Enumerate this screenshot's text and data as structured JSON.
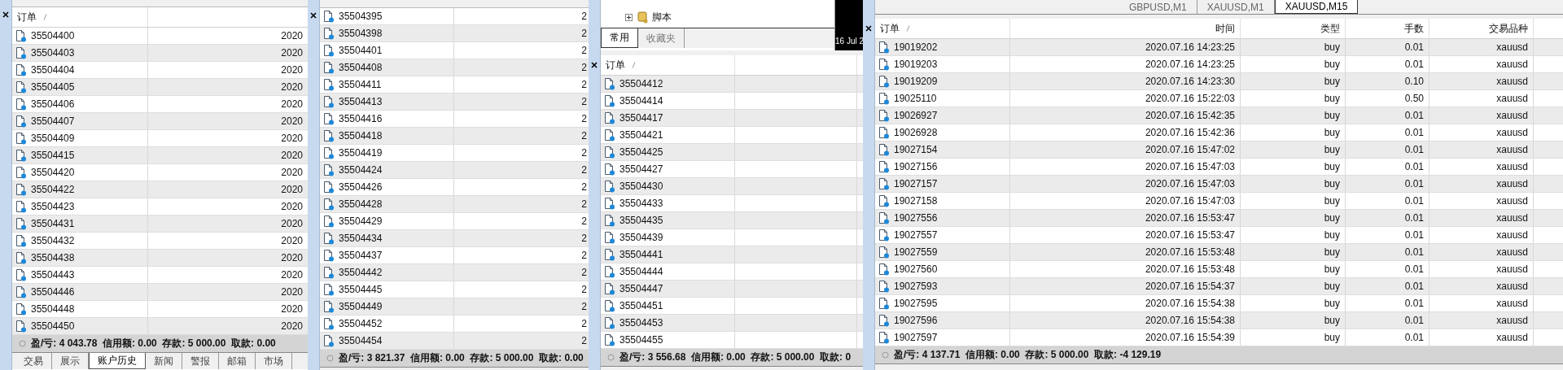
{
  "panels": [
    {
      "columns": [
        "订单"
      ],
      "first_row_shaded": false,
      "rows": [
        [
          "35504400",
          "2020"
        ],
        [
          "35504403",
          "2020"
        ],
        [
          "35504404",
          "2020"
        ],
        [
          "35504405",
          "2020"
        ],
        [
          "35504406",
          "2020"
        ],
        [
          "35504407",
          "2020"
        ],
        [
          "35504409",
          "2020"
        ],
        [
          "35504415",
          "2020"
        ],
        [
          "35504420",
          "2020"
        ],
        [
          "35504422",
          "2020"
        ],
        [
          "35504423",
          "2020"
        ],
        [
          "35504431",
          "2020"
        ],
        [
          "35504432",
          "2020"
        ],
        [
          "35504438",
          "2020"
        ],
        [
          "35504443",
          "2020"
        ],
        [
          "35504446",
          "2020"
        ],
        [
          "35504448",
          "2020"
        ],
        [
          "35504450",
          "2020"
        ]
      ],
      "status": "盈/亏: 4 043.78  信用额: 0.00  存款: 5 000.00  取款: 0.00",
      "bottom_tabs": [
        {
          "label": "交易",
          "selected": false
        },
        {
          "label": "展示",
          "selected": false
        },
        {
          "label": "账户历史",
          "selected": true
        },
        {
          "label": "新闻",
          "selected": false
        },
        {
          "label": "警报",
          "selected": false
        },
        {
          "label": "邮箱",
          "selected": false
        },
        {
          "label": "市场",
          "selected": false
        }
      ]
    },
    {
      "first_row_shaded": false,
      "rows": [
        [
          "35504395",
          "2"
        ],
        [
          "35504398",
          "2"
        ],
        [
          "35504401",
          "2"
        ],
        [
          "35504408",
          "2"
        ],
        [
          "35504411",
          "2"
        ],
        [
          "35504413",
          "2"
        ],
        [
          "35504416",
          "2"
        ],
        [
          "35504418",
          "2"
        ],
        [
          "35504419",
          "2"
        ],
        [
          "35504424",
          "2"
        ],
        [
          "35504426",
          "2"
        ],
        [
          "35504428",
          "2"
        ],
        [
          "35504429",
          "2"
        ],
        [
          "35504434",
          "2"
        ],
        [
          "35504437",
          "2"
        ],
        [
          "35504442",
          "2"
        ],
        [
          "35504445",
          "2"
        ],
        [
          "35504449",
          "2"
        ],
        [
          "35504452",
          "2"
        ],
        [
          "35504454",
          "2"
        ]
      ],
      "status": "盈/亏: 3 821.37  信用额: 0.00  存款: 5 000.00  取款: 0.00"
    },
    {
      "navigator": {
        "item": "脚本",
        "tabs": [
          {
            "label": "常用",
            "selected": true
          },
          {
            "label": "收藏夹",
            "selected": false
          }
        ]
      },
      "chart_label": "16 Jul 2",
      "columns": [
        "订单"
      ],
      "first_row_shaded": true,
      "rows": [
        [
          "35504412",
          ""
        ],
        [
          "35504414"
        ],
        [
          "35504417"
        ],
        [
          "35504421"
        ],
        [
          "35504425"
        ],
        [
          "35504427"
        ],
        [
          "35504430"
        ],
        [
          "35504433"
        ],
        [
          "35504435"
        ],
        [
          "35504439"
        ],
        [
          "35504441"
        ],
        [
          "35504444"
        ],
        [
          "35504447"
        ],
        [
          "35504451"
        ],
        [
          "35504453"
        ],
        [
          "35504455"
        ]
      ],
      "status": "盈/亏: 3 556.68  信用额: 0.00  存款: 5 000.00  取款: 0"
    },
    {
      "chart_tabs": [
        {
          "label": "GBPUSD,M1",
          "selected": false
        },
        {
          "label": "XAUUSD,M1",
          "selected": false
        },
        {
          "label": "XAUUSD,M15",
          "selected": true
        }
      ],
      "columns": [
        "订单",
        "时间",
        "类型",
        "手数",
        "交易品种"
      ],
      "first_row_shaded": true,
      "rows": [
        [
          "19019202",
          "2020.07.16 14:23:25",
          "buy",
          "0.01",
          "xauusd"
        ],
        [
          "19019203",
          "2020.07.16 14:23:25",
          "buy",
          "0.01",
          "xauusd"
        ],
        [
          "19019209",
          "2020.07.16 14:23:30",
          "buy",
          "0.10",
          "xauusd"
        ],
        [
          "19025110",
          "2020.07.16 15:22:03",
          "buy",
          "0.50",
          "xauusd"
        ],
        [
          "19026927",
          "2020.07.16 15:42:35",
          "buy",
          "0.01",
          "xauusd"
        ],
        [
          "19026928",
          "2020.07.16 15:42:36",
          "buy",
          "0.01",
          "xauusd"
        ],
        [
          "19027154",
          "2020.07.16 15:47:02",
          "buy",
          "0.01",
          "xauusd"
        ],
        [
          "19027156",
          "2020.07.16 15:47:03",
          "buy",
          "0.01",
          "xauusd"
        ],
        [
          "19027157",
          "2020.07.16 15:47:03",
          "buy",
          "0.01",
          "xauusd"
        ],
        [
          "19027158",
          "2020.07.16 15:47:03",
          "buy",
          "0.01",
          "xauusd"
        ],
        [
          "19027556",
          "2020.07.16 15:53:47",
          "buy",
          "0.01",
          "xauusd"
        ],
        [
          "19027557",
          "2020.07.16 15:53:47",
          "buy",
          "0.01",
          "xauusd"
        ],
        [
          "19027559",
          "2020.07.16 15:53:48",
          "buy",
          "0.01",
          "xauusd"
        ],
        [
          "19027560",
          "2020.07.16 15:53:48",
          "buy",
          "0.01",
          "xauusd"
        ],
        [
          "19027593",
          "2020.07.16 15:54:37",
          "buy",
          "0.01",
          "xauusd"
        ],
        [
          "19027595",
          "2020.07.16 15:54:38",
          "buy",
          "0.01",
          "xauusd"
        ],
        [
          "19027596",
          "2020.07.16 15:54:38",
          "buy",
          "0.01",
          "xauusd"
        ],
        [
          "19027597",
          "2020.07.16 15:54:39",
          "buy",
          "0.01",
          "xauusd"
        ]
      ],
      "status": "盈/亏: 4 137.71  信用额: 0.00  存款: 5 000.00  取款: -4 129.19"
    }
  ]
}
